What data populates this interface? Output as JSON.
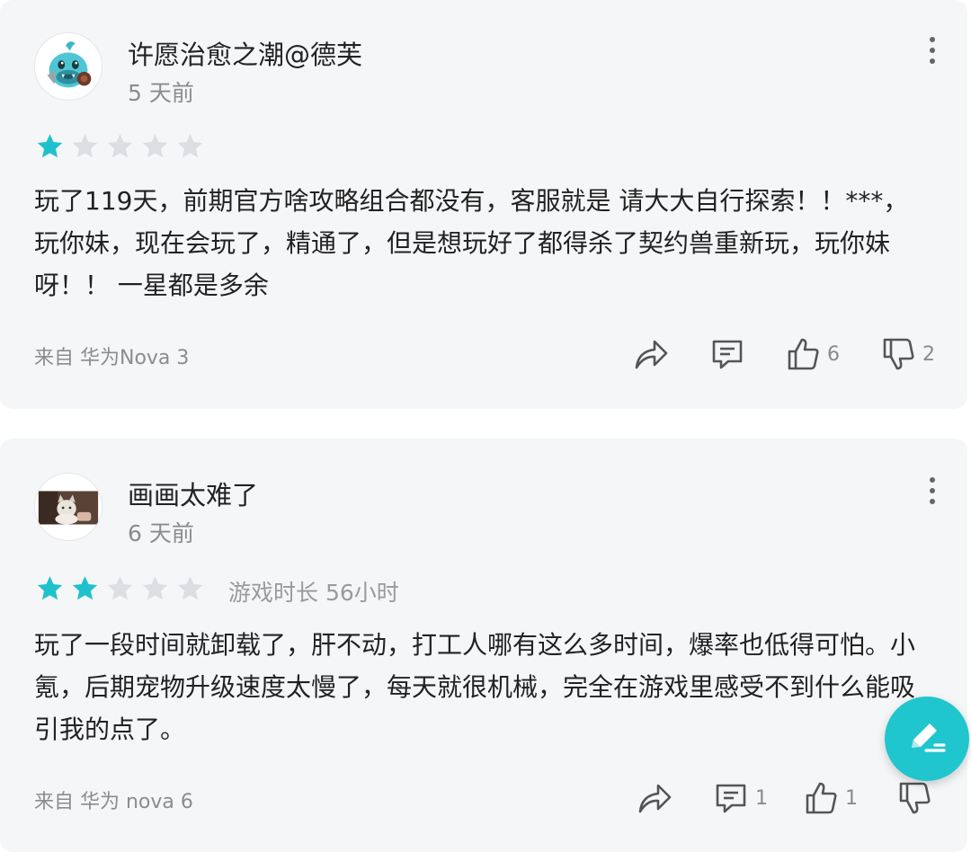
{
  "colors": {
    "accent": "#20c6cd",
    "star_on": "#1fc2cc",
    "star_off": "#dcdee1",
    "card_bg": "#f5f6f8"
  },
  "reviews": [
    {
      "username": "许愿治愈之潮@德芙",
      "time": "5 天前",
      "rating": 1,
      "rating_max": 5,
      "playtime": "",
      "content": "玩了119天，前期官方啥攻略组合都没有，客服就是 请大大自行探索！！***，玩你妹，现在会玩了，精通了，但是想玩好了都得杀了契约兽重新玩，玩你妹呀！！ 一星都是多余",
      "device": "来自 华为Nova 3",
      "avatar_icon": "cartoon-monster-avatar",
      "comment_count": "",
      "like_count": "6",
      "dislike_count": "2"
    },
    {
      "username": "画画太难了",
      "time": "6 天前",
      "rating": 2,
      "rating_max": 5,
      "playtime": "游戏时长 56小时",
      "content": "玩了一段时间就卸载了，肝不动，打工人哪有这么多时间，爆率也低得可怕。小氪，后期宠物升级速度太慢了，每天就很机械，完全在游戏里感受不到什么能吸引我的点了。",
      "device": "来自 华为 nova 6",
      "avatar_icon": "cat-photo-avatar",
      "comment_count": "1",
      "like_count": "1",
      "dislike_count": ""
    }
  ],
  "fab": {
    "icon": "write-review-icon"
  }
}
